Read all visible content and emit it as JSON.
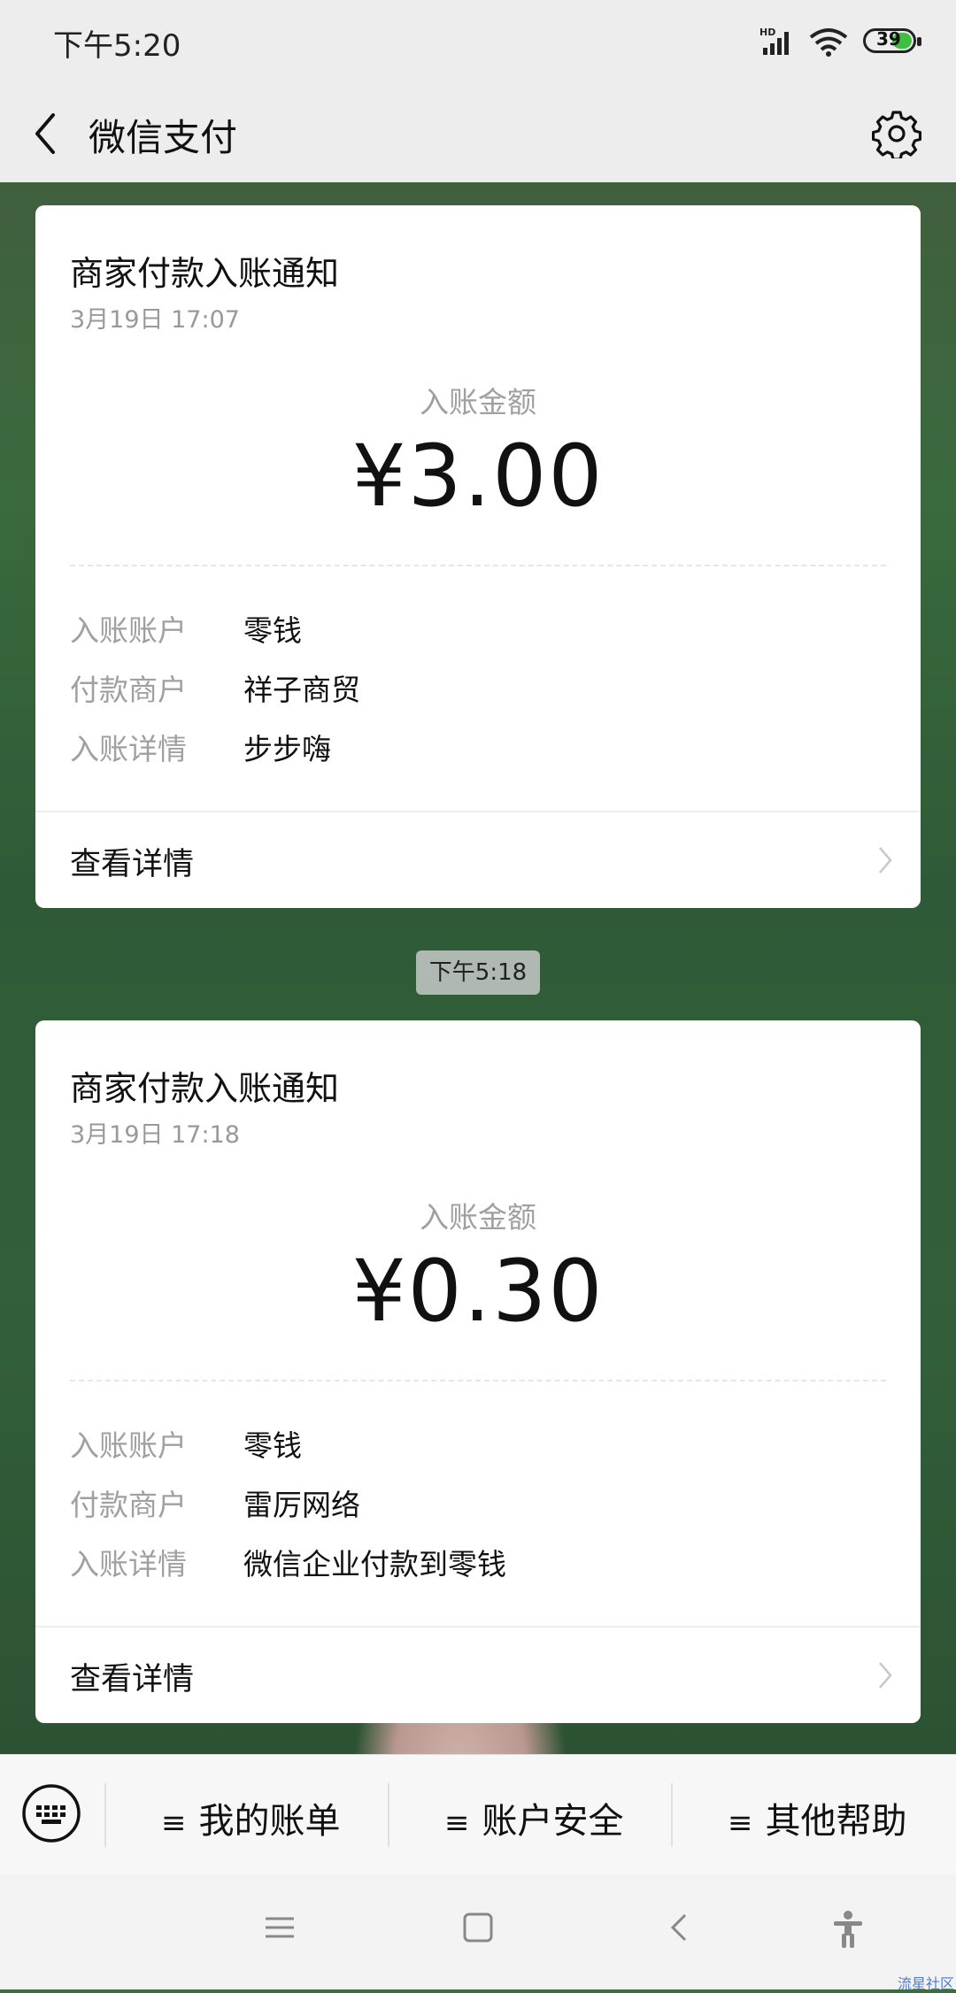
{
  "status": {
    "time": "下午5:20",
    "battery": "39",
    "network": "HD"
  },
  "header": {
    "title": "微信支付"
  },
  "messages": [
    {
      "title": "商家付款入账通知",
      "date": "3月19日  17:07",
      "amount_label": "入账金额",
      "amount": "¥3.00",
      "rows": [
        {
          "k": "入账账户",
          "v": "零钱"
        },
        {
          "k": "付款商户",
          "v": "祥子商贸"
        },
        {
          "k": "入账详情",
          "v": "步步嗨"
        }
      ],
      "detail_link": "查看详情"
    },
    {
      "title": "商家付款入账通知",
      "date": "3月19日  17:18",
      "amount_label": "入账金额",
      "amount": "¥0.30",
      "rows": [
        {
          "k": "入账账户",
          "v": "零钱"
        },
        {
          "k": "付款商户",
          "v": "雷厉网络"
        },
        {
          "k": "入账详情",
          "v": "微信企业付款到零钱"
        }
      ],
      "detail_link": "查看详情"
    }
  ],
  "time_chip": "下午5:18",
  "menu": [
    "我的账单",
    "账户安全",
    "其他帮助"
  ],
  "watermark": "流星社区",
  "colors": {
    "accent_battery": "#3fbf3f",
    "background": "#ededed"
  }
}
